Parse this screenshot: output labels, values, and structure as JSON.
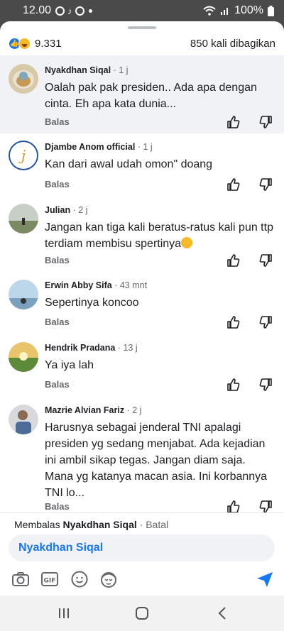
{
  "status": {
    "time": "12.00",
    "battery": "100%"
  },
  "reactions": {
    "count": "9.331",
    "shares": "850 kali dibagikan"
  },
  "comments": [
    {
      "name": "Nyakdhan Siqal",
      "time": "· 1 j",
      "text": "Oalah pak pak presiden.. Ada apa dengan cinta. Eh apa kata dunia...",
      "reply": "Balas"
    },
    {
      "name": "Djambe Anom official",
      "time": "· 1 j",
      "text": "Kan dari awal udah omon\" doang",
      "reply": "Balas"
    },
    {
      "name": "Julian",
      "time": "· 2 j",
      "text": "Jangan kan tiga kali beratus-ratus kali pun ttp terdiam membisu spertinya",
      "reply": "Balas"
    },
    {
      "name": "Erwin Abby Sifa",
      "time": "· 43 mnt",
      "text": "Sepertinya koncoo",
      "reply": "Balas"
    },
    {
      "name": "Hendrik Pradana",
      "time": "· 13 j",
      "text": "Ya iya lah",
      "reply": "Balas"
    },
    {
      "name": "Mazrie Alvian Fariz",
      "time": "· 2 j",
      "text": "Harusnya sebagai jenderal TNI apalagi presiden yg sedang menjabat. Ada kejadian ini ambil sikap tegas. Jangan diam saja. Mana yg katanya macan asia. Ini korbannya TNI lo...",
      "reply": "Balas"
    }
  ],
  "reply_bar": {
    "prefix": "Membalas",
    "target": "Nyakdhan Siqal",
    "cancel": "· Batal",
    "input_value": "Nyakdhan Siqal"
  },
  "colors": {
    "accent": "#1877f2",
    "highlight": "#f0f2f5"
  }
}
